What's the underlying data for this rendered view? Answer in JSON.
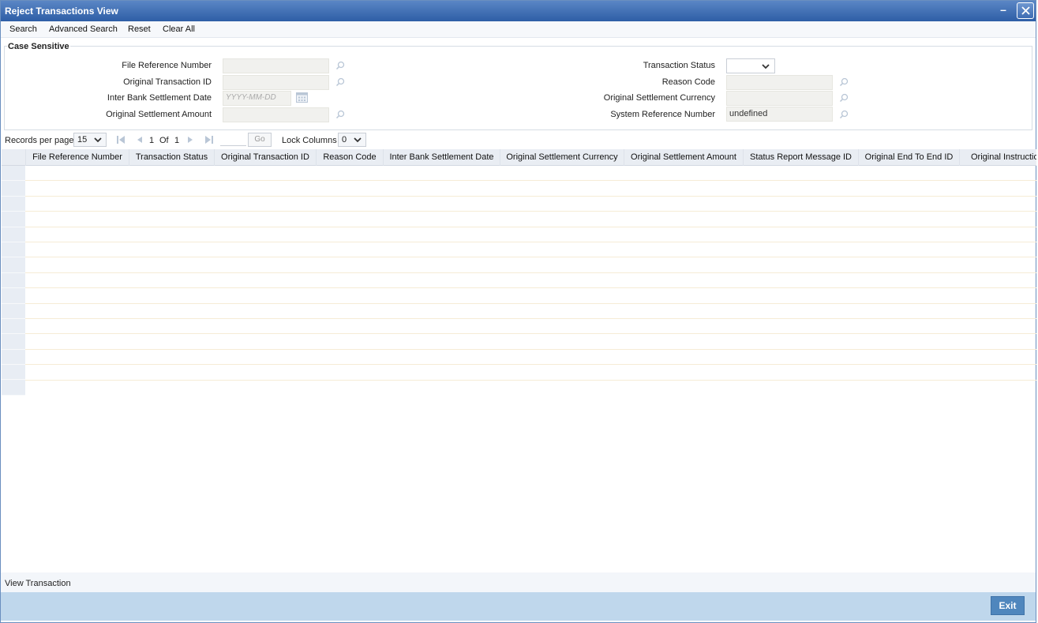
{
  "window": {
    "title": "Reject Transactions View"
  },
  "toolbar": [
    "Search",
    "Advanced Search",
    "Reset",
    "Clear All"
  ],
  "case_section": {
    "label": "Case Sensitive"
  },
  "fields_left": {
    "file_reference_number": {
      "label": "File Reference Number",
      "value": ""
    },
    "original_transaction_id": {
      "label": "Original Transaction ID",
      "value": ""
    },
    "inter_bank_settlement_date": {
      "label": "Inter Bank Settlement Date",
      "placeholder": "YYYY-MM-DD"
    },
    "original_settlement_amount": {
      "label": "Original Settlement Amount",
      "value": ""
    }
  },
  "fields_right": {
    "transaction_status": {
      "label": "Transaction Status",
      "value": ""
    },
    "reason_code": {
      "label": "Reason Code",
      "value": ""
    },
    "original_settlement_currency": {
      "label": "Original Settlement Currency",
      "value": ""
    },
    "system_reference_number": {
      "label": "System Reference Number",
      "value": "undefined"
    }
  },
  "pager": {
    "records_label": "Records per page",
    "records_value": "15",
    "page_current": "1",
    "of_label": "Of",
    "page_total": "1",
    "go_label": "Go",
    "lock_label": "Lock Columns",
    "lock_value": "0"
  },
  "grid": {
    "columns": [
      "File Reference Number",
      "Transaction Status",
      "Original Transaction ID",
      "Reason Code",
      "Inter Bank Settlement Date",
      "Original Settlement Currency",
      "Original Settlement Amount",
      "Status Report Message ID",
      "Original End To End ID",
      "Original Instructio"
    ],
    "empty_rows": 15
  },
  "footer": {
    "view_transaction": "View Transaction",
    "exit": "Exit"
  }
}
